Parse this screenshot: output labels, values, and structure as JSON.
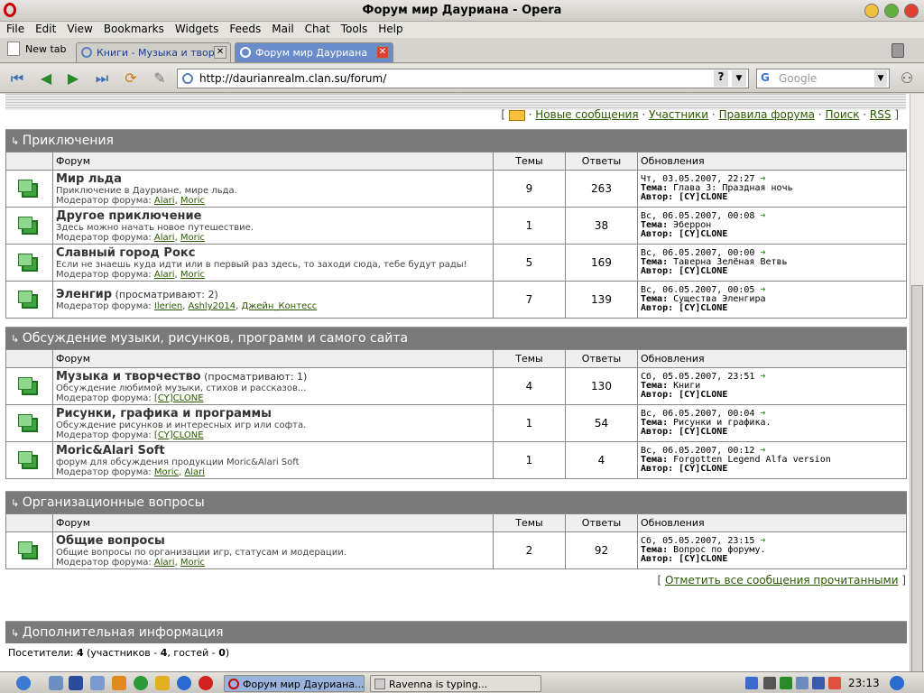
{
  "window": {
    "title": "Форум мир Дауриана - Opera"
  },
  "menu": [
    "File",
    "Edit",
    "View",
    "Bookmarks",
    "Widgets",
    "Feeds",
    "Mail",
    "Chat",
    "Tools",
    "Help"
  ],
  "tabs": [
    {
      "label": "New tab"
    },
    {
      "label": "Книги - Музыка и твор..."
    },
    {
      "label": "Форум мир Дауриана"
    }
  ],
  "nav": {
    "url": "http://daurianrealm.clan.su/forum/",
    "search_placeholder": "Google"
  },
  "toplinks": {
    "new": "Новые сообщения",
    "users": "Участники",
    "rules": "Правила форума",
    "search": "Поиск",
    "rss": "RSS"
  },
  "cols": {
    "forum": "Форум",
    "topics": "Темы",
    "replies": "Ответы",
    "updates": "Обновления"
  },
  "sections": [
    {
      "title": "Приключения",
      "forums": [
        {
          "name": "Мир льда",
          "viewing": "",
          "desc": "Приключение в Дауриане, мире льда.",
          "mod_label": "Модератор форума:",
          "mods": [
            "Alari",
            "Moric"
          ],
          "topics": "9",
          "replies": "263",
          "date": "Чт, 03.05.2007, 22:27",
          "theme_label": "Тема:",
          "theme": "Глава 3: Праздная ночь",
          "author_label": "Автор:",
          "author": "[CY]CLONE"
        },
        {
          "name": "Другое приключение",
          "viewing": "",
          "desc": "Здесь можно начать новое путешествие.",
          "mod_label": "Модератор форума:",
          "mods": [
            "Alari",
            "Moric"
          ],
          "topics": "1",
          "replies": "38",
          "date": "Вс, 06.05.2007, 00:08",
          "theme_label": "Тема:",
          "theme": "Эберрон",
          "author_label": "Автор:",
          "author": "[CY]CLONE"
        },
        {
          "name": "Славный город Рокс",
          "viewing": "",
          "desc": "Если не знаешь куда идти или в первый раз здесь, то заходи сюда, тебе будут рады!",
          "mod_label": "Модератор форума:",
          "mods": [
            "Alari",
            "Moric"
          ],
          "topics": "5",
          "replies": "169",
          "date": "Вс, 06.05.2007, 00:00",
          "theme_label": "Тема:",
          "theme": "Таверна Зелёная Ветвь",
          "author_label": "Автор:",
          "author": "[CY]CLONE"
        },
        {
          "name": "Эленгир",
          "viewing": "(просматривают: 2)",
          "desc": "",
          "mod_label": "Модератор форума:",
          "mods": [
            "Ilerien",
            "Ashly2014",
            "Джейн_Контесс"
          ],
          "topics": "7",
          "replies": "139",
          "date": "Вс, 06.05.2007, 00:05",
          "theme_label": "Тема:",
          "theme": "Существа Эленгира",
          "author_label": "Автор:",
          "author": "[CY]CLONE"
        }
      ]
    },
    {
      "title": "Обсуждение музыки, рисунков, программ и самого сайта",
      "forums": [
        {
          "name": "Музыка и творчество",
          "viewing": "(просматривают: 1)",
          "desc": "Обсуждение любимой музыки, стихов и рассказов...",
          "mod_label": "Модератор форума:",
          "mods": [
            "[CY]CLONE"
          ],
          "topics": "4",
          "replies": "130",
          "date": "Сб, 05.05.2007, 23:51",
          "theme_label": "Тема:",
          "theme": "Книги",
          "author_label": "Автор:",
          "author": "[CY]CLONE"
        },
        {
          "name": "Рисунки, графика и программы",
          "viewing": "",
          "desc": "Обсуждение рисунков и интересных игр или софта.",
          "mod_label": "Модератор форума:",
          "mods": [
            "[CY]CLONE"
          ],
          "topics": "1",
          "replies": "54",
          "date": "Вс, 06.05.2007, 00:04",
          "theme_label": "Тема:",
          "theme": "Рисунки и графика.",
          "author_label": "Автор:",
          "author": "[CY]CLONE"
        },
        {
          "name": "Moric&Alari Soft",
          "viewing": "",
          "desc": "форум для обсуждения продукции Moric&Alari Soft",
          "mod_label": "Модератор форума:",
          "mods": [
            "Moric",
            "Alari"
          ],
          "topics": "1",
          "replies": "4",
          "date": "Вс, 06.05.2007, 00:12",
          "theme_label": "Тема:",
          "theme": "Forgotten Legend Alfa version",
          "author_label": "Автор:",
          "author": "[CY]CLONE"
        }
      ]
    },
    {
      "title": "Организационные вопросы",
      "forums": [
        {
          "name": "Общие вопросы",
          "viewing": "",
          "desc": "Общие вопросы по организации игр, статусам и модерации.",
          "mod_label": "Модератор форума:",
          "mods": [
            "Alari",
            "Moric"
          ],
          "topics": "2",
          "replies": "92",
          "date": "Сб, 05.05.2007, 23:15",
          "theme_label": "Тема:",
          "theme": "Вопрос по форуму.",
          "author_label": "Автор:",
          "author": "[CY]CLONE"
        }
      ]
    }
  ],
  "markall": "Отметить все сообщения прочитанными",
  "info": {
    "title": "Дополнительная информация",
    "visitors_label": "Посетители:",
    "visitors": "4",
    "members_label": "(участников -",
    "members": "4",
    "guests_label": ", гостей -",
    "guests": "0",
    "close": ")"
  },
  "taskbar": {
    "window1": "Форум мир Дауриана...",
    "window2": "Ravenna is typing...",
    "clock": "23:13"
  }
}
